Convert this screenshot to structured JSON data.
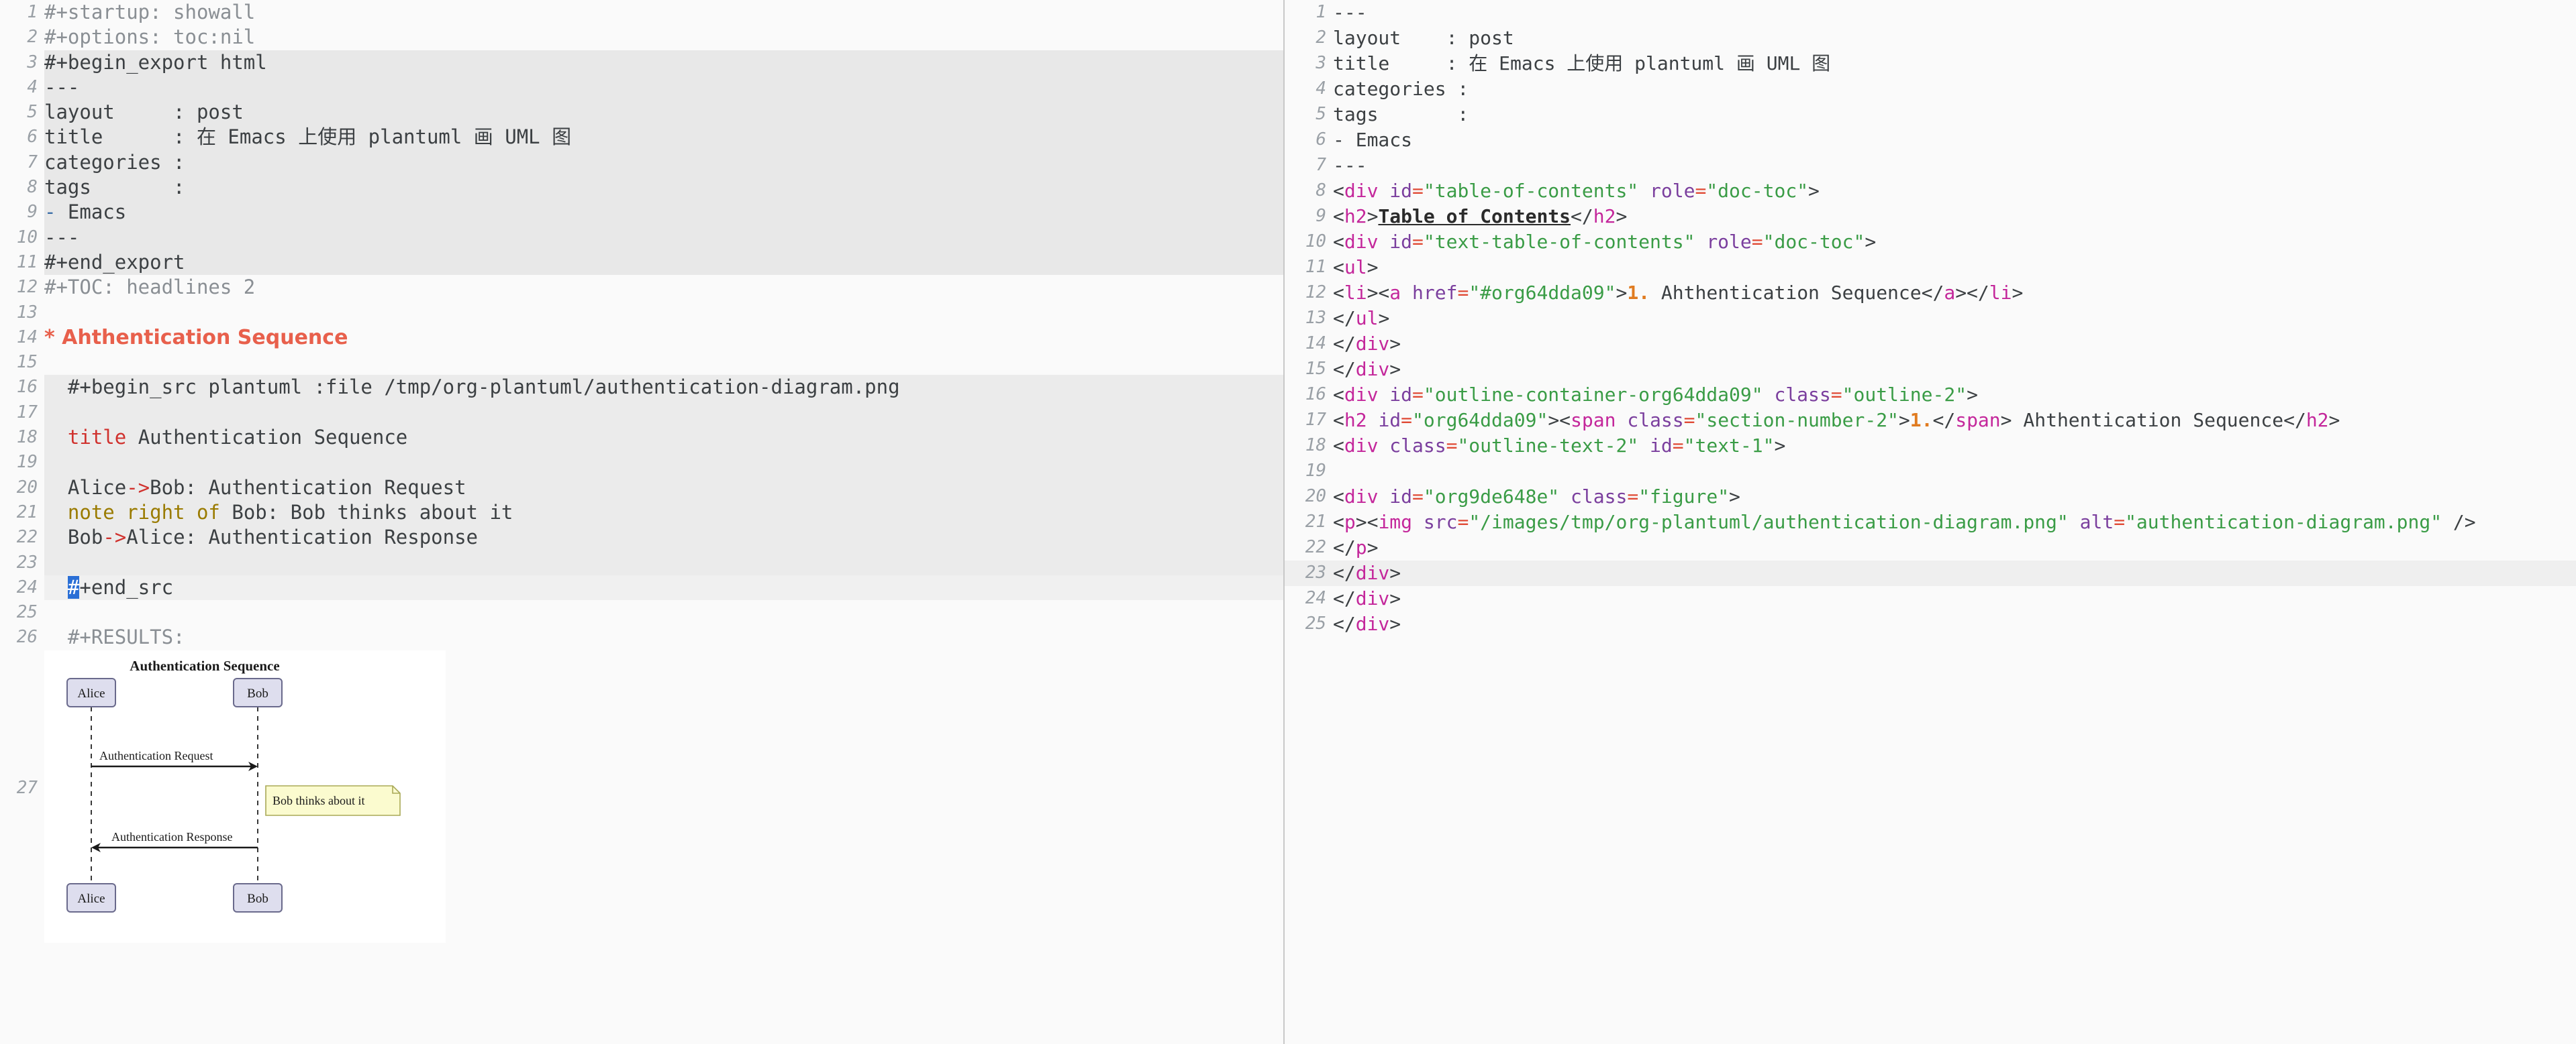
{
  "app": {
    "kind": "emacs-org-mode-editor",
    "panes": 2
  },
  "colors": {
    "background": "#fafafa",
    "block_background": "#e8e8e8",
    "current_line": "#f0f0f0",
    "headline_red": "#e8604c",
    "cursor_blue": "#2a6fd6",
    "html_tag": "#c4279b",
    "html_attr": "#7b3f9e",
    "html_string": "#3a9c46",
    "html_equals": "#e04a35",
    "section_number_orange": "#e07b20",
    "puml_keyword": "#d0312d",
    "puml_note_keyword": "#9a7b00",
    "gutter_gray": "#9aa0a6",
    "divider": "#c8c8c8"
  },
  "left_pane": {
    "name": "org-source-buffer",
    "lines": [
      {
        "n": "1",
        "type": "meta",
        "text": "#+startup: showall"
      },
      {
        "n": "2",
        "type": "meta",
        "text": "#+options: toc:nil"
      },
      {
        "n": "3",
        "type": "block-begin",
        "text": "#+begin_export html"
      },
      {
        "n": "4",
        "type": "block",
        "text": "---"
      },
      {
        "n": "5",
        "type": "block",
        "text": "layout     : post"
      },
      {
        "n": "6",
        "type": "block",
        "text": "title      : 在 Emacs 上使用 plantuml 画 UML 图"
      },
      {
        "n": "7",
        "type": "block",
        "text": "categories :"
      },
      {
        "n": "8",
        "type": "block",
        "text": "tags       :"
      },
      {
        "n": "9",
        "type": "block-list",
        "dash": "-",
        "text": " Emacs"
      },
      {
        "n": "10",
        "type": "block",
        "text": "---"
      },
      {
        "n": "11",
        "type": "block-end",
        "text": "#+end_export"
      },
      {
        "n": "12",
        "type": "meta",
        "text": "#+TOC: headlines 2"
      },
      {
        "n": "13",
        "type": "blank",
        "text": ""
      },
      {
        "n": "14",
        "type": "headline",
        "text": "* Ahthentication Sequence"
      },
      {
        "n": "15",
        "type": "blank",
        "text": ""
      },
      {
        "n": "16",
        "type": "src-begin",
        "text": "  #+begin_src plantuml :file /tmp/org-plantuml/authentication-diagram.png"
      },
      {
        "n": "17",
        "type": "src",
        "text": ""
      },
      {
        "n": "18",
        "type": "src-title",
        "kw": "title",
        "text": " Authentication Sequence"
      },
      {
        "n": "19",
        "type": "src",
        "text": ""
      },
      {
        "n": "20",
        "type": "src-arrow",
        "from": "Alice",
        "arrow": "->",
        "rest": "Bob: Authentication Request"
      },
      {
        "n": "21",
        "type": "src-note",
        "kw": "note right of",
        "rest": " Bob: Bob thinks about it"
      },
      {
        "n": "22",
        "type": "src-arrow",
        "from": "Bob",
        "arrow": "->",
        "rest": "Alice: Authentication Response"
      },
      {
        "n": "23",
        "type": "src",
        "text": ""
      },
      {
        "n": "24",
        "type": "src-end-cursor",
        "cursor_char": "#",
        "text": "+end_src"
      },
      {
        "n": "25",
        "type": "blank",
        "text": ""
      },
      {
        "n": "26",
        "type": "results",
        "text": "  #+RESULTS:"
      },
      {
        "n": "27",
        "type": "image",
        "text": ""
      }
    ]
  },
  "right_pane": {
    "name": "html-export-buffer",
    "current_line": 23,
    "lines": [
      {
        "n": "1",
        "tokens": [
          {
            "t": "text",
            "v": "---"
          }
        ]
      },
      {
        "n": "2",
        "tokens": [
          {
            "t": "text",
            "v": "layout    : post"
          }
        ]
      },
      {
        "n": "3",
        "tokens": [
          {
            "t": "text",
            "v": "title     : 在 Emacs 上使用 plantuml 画 UML 图"
          }
        ]
      },
      {
        "n": "4",
        "tokens": [
          {
            "t": "text",
            "v": "categories :"
          }
        ]
      },
      {
        "n": "5",
        "tokens": [
          {
            "t": "text",
            "v": "tags       :"
          }
        ]
      },
      {
        "n": "6",
        "tokens": [
          {
            "t": "text",
            "v": "- Emacs"
          }
        ]
      },
      {
        "n": "7",
        "tokens": [
          {
            "t": "text",
            "v": "---"
          }
        ]
      },
      {
        "n": "8",
        "tokens": [
          {
            "t": "punct",
            "v": "<"
          },
          {
            "t": "tag",
            "v": "div"
          },
          {
            "t": "text",
            "v": " "
          },
          {
            "t": "attr",
            "v": "id"
          },
          {
            "t": "eq",
            "v": "="
          },
          {
            "t": "str",
            "v": "\"table-of-contents\""
          },
          {
            "t": "text",
            "v": " "
          },
          {
            "t": "attr",
            "v": "role"
          },
          {
            "t": "eq",
            "v": "="
          },
          {
            "t": "str",
            "v": "\"doc-toc\""
          },
          {
            "t": "punct",
            "v": ">"
          }
        ]
      },
      {
        "n": "9",
        "tokens": [
          {
            "t": "punct",
            "v": "<"
          },
          {
            "t": "tag",
            "v": "h2"
          },
          {
            "t": "punct",
            "v": ">"
          },
          {
            "t": "bold",
            "v": "Table of Contents"
          },
          {
            "t": "punct",
            "v": "</"
          },
          {
            "t": "tag",
            "v": "h2"
          },
          {
            "t": "punct",
            "v": ">"
          }
        ]
      },
      {
        "n": "10",
        "tokens": [
          {
            "t": "punct",
            "v": "<"
          },
          {
            "t": "tag",
            "v": "div"
          },
          {
            "t": "text",
            "v": " "
          },
          {
            "t": "attr",
            "v": "id"
          },
          {
            "t": "eq",
            "v": "="
          },
          {
            "t": "str",
            "v": "\"text-table-of-contents\""
          },
          {
            "t": "text",
            "v": " "
          },
          {
            "t": "attr",
            "v": "role"
          },
          {
            "t": "eq",
            "v": "="
          },
          {
            "t": "str",
            "v": "\"doc-toc\""
          },
          {
            "t": "punct",
            "v": ">"
          }
        ]
      },
      {
        "n": "11",
        "tokens": [
          {
            "t": "punct",
            "v": "<"
          },
          {
            "t": "tag",
            "v": "ul"
          },
          {
            "t": "punct",
            "v": ">"
          }
        ]
      },
      {
        "n": "12",
        "tokens": [
          {
            "t": "punct",
            "v": "<"
          },
          {
            "t": "tag",
            "v": "li"
          },
          {
            "t": "punct",
            "v": "><"
          },
          {
            "t": "tag",
            "v": "a"
          },
          {
            "t": "text",
            "v": " "
          },
          {
            "t": "attr",
            "v": "href"
          },
          {
            "t": "eq",
            "v": "="
          },
          {
            "t": "str",
            "v": "\"#org64dda09\""
          },
          {
            "t": "punct",
            "v": ">"
          },
          {
            "t": "num",
            "v": "1."
          },
          {
            "t": "text",
            "v": " Ahthentication Sequence"
          },
          {
            "t": "punct",
            "v": "</"
          },
          {
            "t": "tag",
            "v": "a"
          },
          {
            "t": "punct",
            "v": "></"
          },
          {
            "t": "tag",
            "v": "li"
          },
          {
            "t": "punct",
            "v": ">"
          }
        ]
      },
      {
        "n": "13",
        "tokens": [
          {
            "t": "punct",
            "v": "</"
          },
          {
            "t": "tag",
            "v": "ul"
          },
          {
            "t": "punct",
            "v": ">"
          }
        ]
      },
      {
        "n": "14",
        "tokens": [
          {
            "t": "punct",
            "v": "</"
          },
          {
            "t": "tag",
            "v": "div"
          },
          {
            "t": "punct",
            "v": ">"
          }
        ]
      },
      {
        "n": "15",
        "tokens": [
          {
            "t": "punct",
            "v": "</"
          },
          {
            "t": "tag",
            "v": "div"
          },
          {
            "t": "punct",
            "v": ">"
          }
        ]
      },
      {
        "n": "16",
        "tokens": [
          {
            "t": "punct",
            "v": "<"
          },
          {
            "t": "tag",
            "v": "div"
          },
          {
            "t": "text",
            "v": " "
          },
          {
            "t": "attr",
            "v": "id"
          },
          {
            "t": "eq",
            "v": "="
          },
          {
            "t": "str",
            "v": "\"outline-container-org64dda09\""
          },
          {
            "t": "text",
            "v": " "
          },
          {
            "t": "attr",
            "v": "class"
          },
          {
            "t": "eq",
            "v": "="
          },
          {
            "t": "str",
            "v": "\"outline-2\""
          },
          {
            "t": "punct",
            "v": ">"
          }
        ]
      },
      {
        "n": "17",
        "tokens": [
          {
            "t": "punct",
            "v": "<"
          },
          {
            "t": "tag",
            "v": "h2"
          },
          {
            "t": "text",
            "v": " "
          },
          {
            "t": "attr",
            "v": "id"
          },
          {
            "t": "eq",
            "v": "="
          },
          {
            "t": "str",
            "v": "\"org64dda09\""
          },
          {
            "t": "punct",
            "v": "><"
          },
          {
            "t": "tag",
            "v": "span"
          },
          {
            "t": "text",
            "v": " "
          },
          {
            "t": "attr",
            "v": "class"
          },
          {
            "t": "eq",
            "v": "="
          },
          {
            "t": "str",
            "v": "\"section-number-2\""
          },
          {
            "t": "punct",
            "v": ">"
          },
          {
            "t": "num",
            "v": "1."
          },
          {
            "t": "punct",
            "v": "</"
          },
          {
            "t": "tag",
            "v": "span"
          },
          {
            "t": "punct",
            "v": ">"
          },
          {
            "t": "text",
            "v": " Ahthentication Sequence"
          },
          {
            "t": "punct",
            "v": "</"
          },
          {
            "t": "tag",
            "v": "h2"
          },
          {
            "t": "punct",
            "v": ">"
          }
        ]
      },
      {
        "n": "18",
        "tokens": [
          {
            "t": "punct",
            "v": "<"
          },
          {
            "t": "tag",
            "v": "div"
          },
          {
            "t": "text",
            "v": " "
          },
          {
            "t": "attr",
            "v": "class"
          },
          {
            "t": "eq",
            "v": "="
          },
          {
            "t": "str",
            "v": "\"outline-text-2\""
          },
          {
            "t": "text",
            "v": " "
          },
          {
            "t": "attr",
            "v": "id"
          },
          {
            "t": "eq",
            "v": "="
          },
          {
            "t": "str",
            "v": "\"text-1\""
          },
          {
            "t": "punct",
            "v": ">"
          }
        ]
      },
      {
        "n": "19",
        "tokens": []
      },
      {
        "n": "20",
        "tokens": [
          {
            "t": "punct",
            "v": "<"
          },
          {
            "t": "tag",
            "v": "div"
          },
          {
            "t": "text",
            "v": " "
          },
          {
            "t": "attr",
            "v": "id"
          },
          {
            "t": "eq",
            "v": "="
          },
          {
            "t": "str",
            "v": "\"org9de648e\""
          },
          {
            "t": "text",
            "v": " "
          },
          {
            "t": "attr",
            "v": "class"
          },
          {
            "t": "eq",
            "v": "="
          },
          {
            "t": "str",
            "v": "\"figure\""
          },
          {
            "t": "punct",
            "v": ">"
          }
        ]
      },
      {
        "n": "21",
        "tokens": [
          {
            "t": "punct",
            "v": "<"
          },
          {
            "t": "tag",
            "v": "p"
          },
          {
            "t": "punct",
            "v": "><"
          },
          {
            "t": "tag",
            "v": "img"
          },
          {
            "t": "text",
            "v": " "
          },
          {
            "t": "attr",
            "v": "src"
          },
          {
            "t": "eq",
            "v": "="
          },
          {
            "t": "str",
            "v": "\"/images/tmp/org-plantuml/authentication-diagram.png\""
          },
          {
            "t": "text",
            "v": " "
          },
          {
            "t": "attr",
            "v": "alt"
          },
          {
            "t": "eq",
            "v": "="
          },
          {
            "t": "str",
            "v": "\"authentication-diagram.png\""
          },
          {
            "t": "punct",
            "v": " />"
          }
        ]
      },
      {
        "n": "22",
        "tokens": [
          {
            "t": "punct",
            "v": "</"
          },
          {
            "t": "tag",
            "v": "p"
          },
          {
            "t": "punct",
            "v": ">"
          }
        ]
      },
      {
        "n": "23",
        "tokens": [
          {
            "t": "punct",
            "v": "</"
          },
          {
            "t": "tag",
            "v": "div"
          },
          {
            "t": "punct",
            "v": ">"
          }
        ]
      },
      {
        "n": "24",
        "tokens": [
          {
            "t": "punct",
            "v": "</"
          },
          {
            "t": "tag",
            "v": "div"
          },
          {
            "t": "punct",
            "v": ">"
          }
        ]
      },
      {
        "n": "25",
        "tokens": [
          {
            "t": "punct",
            "v": "</"
          },
          {
            "t": "tag",
            "v": "div"
          },
          {
            "t": "punct",
            "v": ">"
          }
        ]
      }
    ]
  },
  "diagram": {
    "name": "plantuml-sequence-diagram",
    "title": "Authentication Sequence",
    "participants": [
      "Alice",
      "Bob"
    ],
    "messages": [
      {
        "from": "Alice",
        "to": "Bob",
        "label": "Authentication Request",
        "direction": "right"
      },
      {
        "from": "Bob",
        "to": "Alice",
        "label": "Authentication Response",
        "direction": "left"
      }
    ],
    "notes": [
      {
        "side": "right of",
        "target": "Bob",
        "text": "Bob thinks about it"
      }
    ],
    "colors": {
      "participant_fill": "#dedeee",
      "participant_stroke": "#6a6a8c",
      "note_fill": "#fbfbcf",
      "note_stroke": "#a9a957",
      "lifeline": "#383838",
      "arrow": "#1a1a1a"
    }
  }
}
